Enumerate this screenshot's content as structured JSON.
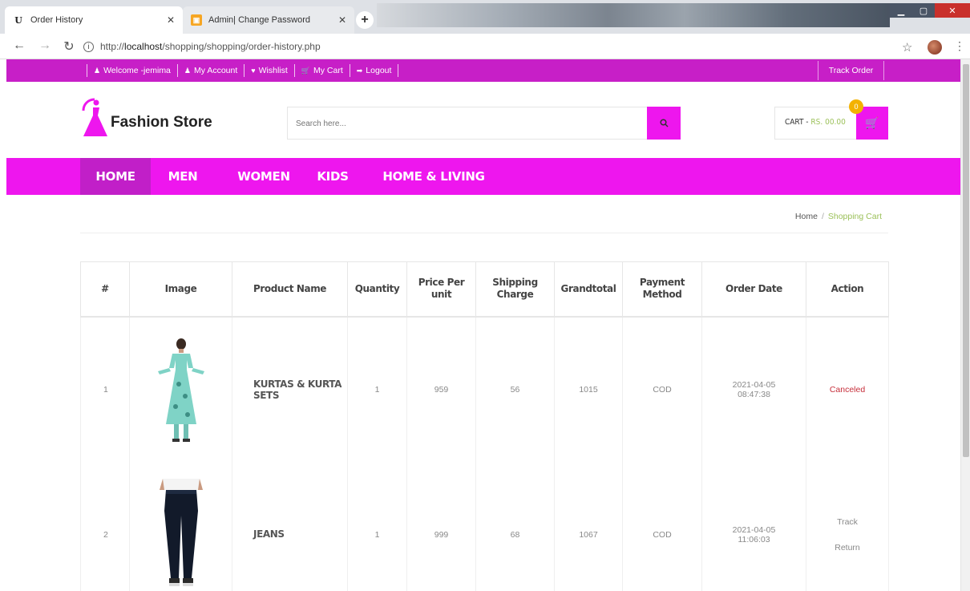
{
  "browser": {
    "tabs": [
      {
        "title": "Order History",
        "favicon": "U"
      },
      {
        "title": "Admin| Change Password",
        "favicon": "icon"
      }
    ],
    "url_prefix": "http://",
    "url_host": "localhost",
    "url_path": "/shopping/shopping/order-history.php"
  },
  "topbar": {
    "links": [
      {
        "icon": "user-icon",
        "label": "Welcome -jemima"
      },
      {
        "icon": "user-icon",
        "label": "My Account"
      },
      {
        "icon": "heart-icon",
        "label": "Wishlist"
      },
      {
        "icon": "cart-icon",
        "label": "My Cart"
      },
      {
        "icon": "logout-icon",
        "label": "Logout"
      }
    ],
    "track_order": "Track Order"
  },
  "header": {
    "logo_text": "Fashion Store",
    "search_placeholder": "Search here...",
    "cart_label": "CART -",
    "cart_amount": "RS. 00.00",
    "cart_count": "0"
  },
  "nav": {
    "items": [
      "HOME",
      "MEN",
      "WOMEN",
      "KIDS",
      "HOME & LIVING"
    ],
    "active": "HOME"
  },
  "breadcrumb": {
    "home": "Home",
    "separator": "/",
    "current": "Shopping Cart"
  },
  "table": {
    "headers": {
      "num": "#",
      "image": "Image",
      "product_name": "Product Name",
      "quantity": "Quantity",
      "price_per_unit": "Price Per unit",
      "shipping_charge": "Shipping Charge",
      "grandtotal": "Grandtotal",
      "payment_method": "Payment Method",
      "order_date": "Order Date",
      "action": "Action"
    },
    "rows": [
      {
        "num": "1",
        "image": "kurta-product-image",
        "product_name": "KURTAS & KURTA SETS",
        "quantity": "1",
        "price": "959",
        "shipping": "56",
        "grandtotal": "1015",
        "payment": "COD",
        "date": "2021-04-05",
        "time": "08:47:38",
        "status": "Canceled"
      },
      {
        "num": "2",
        "image": "jeans-product-image",
        "product_name": "JEANS",
        "quantity": "1",
        "price": "999",
        "shipping": "68",
        "grandtotal": "1067",
        "payment": "COD",
        "date": "2021-04-05",
        "time": "11:06:03",
        "action_track": "Track",
        "action_return": "Return"
      }
    ]
  },
  "colors": {
    "topbar": "#c71fc7",
    "accent": "#ee16ee",
    "nav_active": "#c11fc8",
    "cart_amount": "#9cc15a",
    "canceled": "#c62e3a"
  }
}
